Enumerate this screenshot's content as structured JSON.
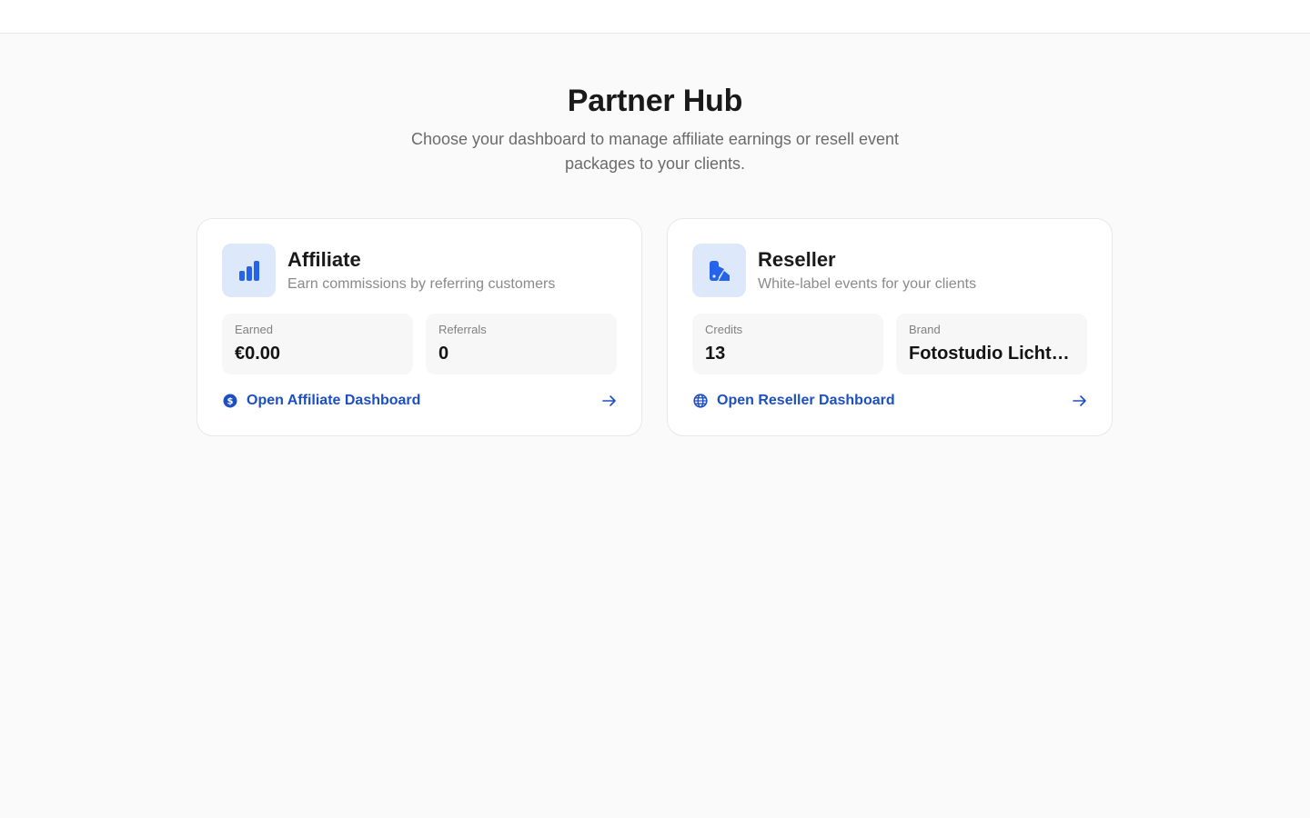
{
  "hero": {
    "title": "Partner Hub",
    "subtitle": "Choose your dashboard to manage affiliate earnings or resell event packages to your clients."
  },
  "colors": {
    "accent": "#1d4fc4",
    "icon_blue": "#2563eb",
    "icon_tile": "#dde9fb",
    "background": "#fafafa"
  },
  "cards": {
    "affiliate": {
      "icon": "bar-chart-icon",
      "title": "Affiliate",
      "subtitle": "Earn commissions by referring customers",
      "stats": [
        {
          "label": "Earned",
          "value": "€0.00"
        },
        {
          "label": "Referrals",
          "value": "0"
        }
      ],
      "link_icon": "dollar-circle-icon",
      "link_label": "Open Affiliate Dashboard",
      "arrow_icon": "arrow-right-icon"
    },
    "reseller": {
      "icon": "palette-icon",
      "title": "Reseller",
      "subtitle": "White-label events for your clients",
      "stats": [
        {
          "label": "Credits",
          "value": "13"
        },
        {
          "label": "Brand",
          "value": "Fotostudio Lichtbl…"
        }
      ],
      "link_icon": "globe-icon",
      "link_label": "Open Reseller Dashboard",
      "arrow_icon": "arrow-right-icon"
    }
  }
}
